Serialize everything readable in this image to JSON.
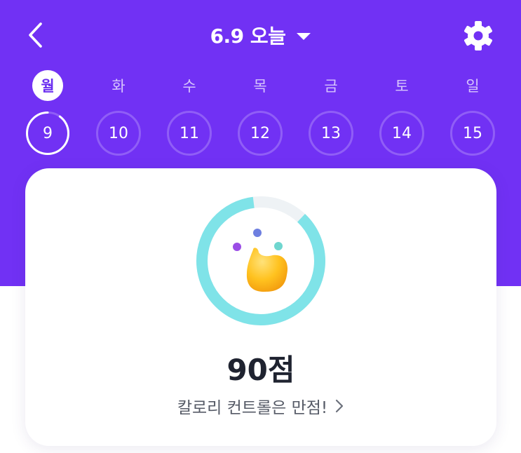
{
  "colors": {
    "header_bg": "#7131f4",
    "ring_progress": "#7fe3e8",
    "ring_track": "#eef2f5",
    "score_text": "#1f2330",
    "active_weekday_text": "#6a2ef0"
  },
  "header": {
    "title": "6.9 오늘",
    "back_icon": "chevron-left-icon",
    "dropdown_icon": "caret-down-icon",
    "settings_icon": "gear-icon"
  },
  "week": {
    "selected_index": 0,
    "days": [
      {
        "weekday": "월",
        "date": "9"
      },
      {
        "weekday": "화",
        "date": "10"
      },
      {
        "weekday": "수",
        "date": "11"
      },
      {
        "weekday": "목",
        "date": "12"
      },
      {
        "weekday": "금",
        "date": "13"
      },
      {
        "weekday": "토",
        "date": "14"
      },
      {
        "weekday": "일",
        "date": "15"
      }
    ]
  },
  "score_card": {
    "score_label": "90점",
    "score_fraction": 0.9,
    "message": "칼로리 컨트롤은 만점!",
    "message_icon": "chevron-right-icon"
  }
}
